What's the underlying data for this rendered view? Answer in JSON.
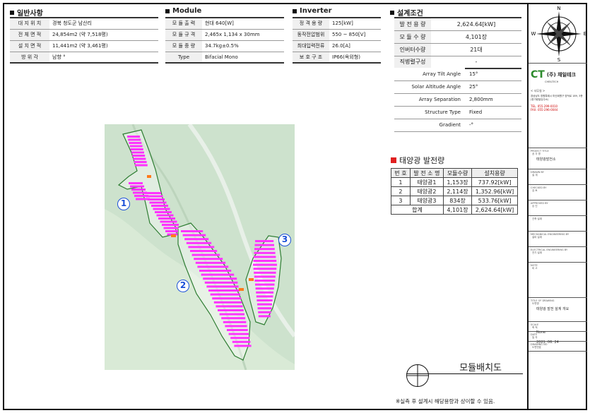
{
  "general": {
    "title": "일반사항",
    "rows": [
      {
        "k": "대 지 위 치",
        "v": "경북 청도군 남산리"
      },
      {
        "k": "전 체 면 적",
        "v": "24,854m2 (약 7,518평)"
      },
      {
        "k": "설 치 면 적",
        "v": "11,441m2 (약 3,461평)"
      },
      {
        "k": "방 위 각",
        "v": "남향 °"
      }
    ]
  },
  "module": {
    "title": "Module",
    "rows": [
      {
        "k": "모 듈 출 력",
        "v": "현대 640[W]"
      },
      {
        "k": "모 듈 규 격",
        "v": "2,465x 1,134 x 30mm"
      },
      {
        "k": "모 듈 중 량",
        "v": "34.7kg±0.5%"
      },
      {
        "k": "Type",
        "v": "Bifacial Mono"
      }
    ]
  },
  "inverter": {
    "title": "Inverter",
    "rows": [
      {
        "k": "정 격 용 량",
        "v": "125[kW]"
      },
      {
        "k": "동작전압범위",
        "v": "550 ~ 850[V]"
      },
      {
        "k": "최대입력전류",
        "v": "26.0[A]"
      },
      {
        "k": "보 호 구 조",
        "v": "IP66(옥외형)"
      }
    ]
  },
  "design": {
    "title": "설계조건",
    "rows": [
      {
        "k": "발 전 용 량",
        "v": "2,624.64[kW]"
      },
      {
        "k": "모 듈 수 량",
        "v": "4,101장"
      },
      {
        "k": "인버터수량",
        "v": "21대"
      },
      {
        "k": "직병렬구성",
        "v": "-"
      }
    ],
    "rows2": [
      {
        "k": "Array Tilt Angle",
        "v": "15°"
      },
      {
        "k": "Solar Altitude Angle",
        "v": "25°"
      },
      {
        "k": "Array Separation",
        "v": "2,800mm"
      },
      {
        "k": "Structure Type",
        "v": "Fixed"
      },
      {
        "k": "Gradient",
        "v": "-°"
      }
    ]
  },
  "plants": {
    "title": "태양광 발전량",
    "headers": [
      "번 호",
      "발 전 소 명",
      "모듈수량",
      "설치용량"
    ],
    "rows": [
      [
        "1",
        "태양광1",
        "1,153장",
        "737.92[kW]"
      ],
      [
        "2",
        "태양광2",
        "2,114장",
        "1,352.96[kW]"
      ],
      [
        "3",
        "태양광3",
        "834장",
        "533.76[kW]"
      ]
    ],
    "total": [
      "합계",
      "4,101장",
      "2,624.64[kW]"
    ]
  },
  "map": {
    "callouts": [
      "1",
      "2",
      "3"
    ],
    "module_color": "#ff33ff",
    "boundary_color": "#2e7d32"
  },
  "compass": {
    "n": "N",
    "s": "S",
    "e": "E",
    "w": "W"
  },
  "company": {
    "logo_text": "CT",
    "name": "(주) 채일테크",
    "sub": "CHEILTECH",
    "office_label": "< 사무실 >",
    "address": "경상남도 창원특례시 마산회원구 양덕로 189, 3층(한가람빌딩주소)",
    "tel": "TEL. 055-299-0010",
    "fax": "FAX. 055-296-0044"
  },
  "title_block": [
    {
      "label": "PROJECT TITLE",
      "sub": "공 사 명",
      "value": "태양광발전소"
    },
    {
      "label": "DRAWN BY",
      "sub": "설 계",
      "value": ""
    },
    {
      "label": "CHECKED BY",
      "sub": "검 토",
      "value": ""
    },
    {
      "label": "APPROVED BY",
      "sub": "승 인",
      "value": ""
    },
    {
      "label": "",
      "sub": "건축 설계",
      "value": ""
    },
    {
      "label": "MECHANICAL ENGINEERING BY",
      "sub": "설비 설계",
      "value": ""
    },
    {
      "label": "ELECTRICAL ENGINEERING BY",
      "sub": "전기 설계",
      "value": ""
    },
    {
      "label": "NOTE",
      "sub": "비 고",
      "value": ""
    },
    {
      "label": "TITLE OF DRAWING",
      "sub": "도면명",
      "value": "태양광 발전 설계 개요"
    },
    {
      "label": "SCALE",
      "sub": "축 척",
      "value": "None"
    },
    {
      "label": "DATE",
      "sub": "일 자",
      "value": "2021. 06. 24"
    },
    {
      "label": "DRAWING NO",
      "sub": "도면번호",
      "value": ""
    }
  ],
  "footer": {
    "title": "모듈배치도",
    "note": "※실측 후 설계시 해당용량과 상이할 수 있음."
  }
}
